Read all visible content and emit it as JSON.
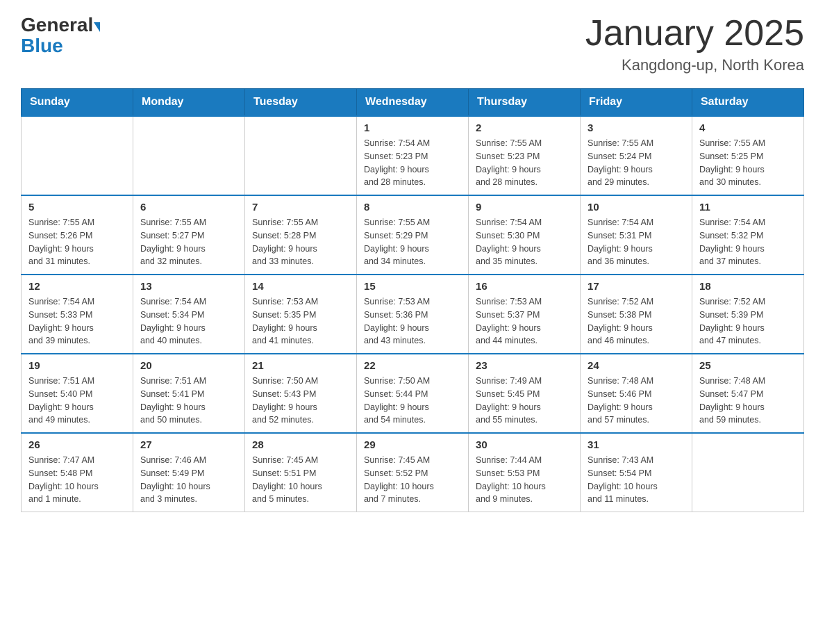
{
  "header": {
    "logo_general": "General",
    "logo_blue": "Blue",
    "main_title": "January 2025",
    "subtitle": "Kangdong-up, North Korea"
  },
  "days_of_week": [
    "Sunday",
    "Monday",
    "Tuesday",
    "Wednesday",
    "Thursday",
    "Friday",
    "Saturday"
  ],
  "weeks": [
    [
      {
        "day": "",
        "info": ""
      },
      {
        "day": "",
        "info": ""
      },
      {
        "day": "",
        "info": ""
      },
      {
        "day": "1",
        "info": "Sunrise: 7:54 AM\nSunset: 5:23 PM\nDaylight: 9 hours\nand 28 minutes."
      },
      {
        "day": "2",
        "info": "Sunrise: 7:55 AM\nSunset: 5:23 PM\nDaylight: 9 hours\nand 28 minutes."
      },
      {
        "day": "3",
        "info": "Sunrise: 7:55 AM\nSunset: 5:24 PM\nDaylight: 9 hours\nand 29 minutes."
      },
      {
        "day": "4",
        "info": "Sunrise: 7:55 AM\nSunset: 5:25 PM\nDaylight: 9 hours\nand 30 minutes."
      }
    ],
    [
      {
        "day": "5",
        "info": "Sunrise: 7:55 AM\nSunset: 5:26 PM\nDaylight: 9 hours\nand 31 minutes."
      },
      {
        "day": "6",
        "info": "Sunrise: 7:55 AM\nSunset: 5:27 PM\nDaylight: 9 hours\nand 32 minutes."
      },
      {
        "day": "7",
        "info": "Sunrise: 7:55 AM\nSunset: 5:28 PM\nDaylight: 9 hours\nand 33 minutes."
      },
      {
        "day": "8",
        "info": "Sunrise: 7:55 AM\nSunset: 5:29 PM\nDaylight: 9 hours\nand 34 minutes."
      },
      {
        "day": "9",
        "info": "Sunrise: 7:54 AM\nSunset: 5:30 PM\nDaylight: 9 hours\nand 35 minutes."
      },
      {
        "day": "10",
        "info": "Sunrise: 7:54 AM\nSunset: 5:31 PM\nDaylight: 9 hours\nand 36 minutes."
      },
      {
        "day": "11",
        "info": "Sunrise: 7:54 AM\nSunset: 5:32 PM\nDaylight: 9 hours\nand 37 minutes."
      }
    ],
    [
      {
        "day": "12",
        "info": "Sunrise: 7:54 AM\nSunset: 5:33 PM\nDaylight: 9 hours\nand 39 minutes."
      },
      {
        "day": "13",
        "info": "Sunrise: 7:54 AM\nSunset: 5:34 PM\nDaylight: 9 hours\nand 40 minutes."
      },
      {
        "day": "14",
        "info": "Sunrise: 7:53 AM\nSunset: 5:35 PM\nDaylight: 9 hours\nand 41 minutes."
      },
      {
        "day": "15",
        "info": "Sunrise: 7:53 AM\nSunset: 5:36 PM\nDaylight: 9 hours\nand 43 minutes."
      },
      {
        "day": "16",
        "info": "Sunrise: 7:53 AM\nSunset: 5:37 PM\nDaylight: 9 hours\nand 44 minutes."
      },
      {
        "day": "17",
        "info": "Sunrise: 7:52 AM\nSunset: 5:38 PM\nDaylight: 9 hours\nand 46 minutes."
      },
      {
        "day": "18",
        "info": "Sunrise: 7:52 AM\nSunset: 5:39 PM\nDaylight: 9 hours\nand 47 minutes."
      }
    ],
    [
      {
        "day": "19",
        "info": "Sunrise: 7:51 AM\nSunset: 5:40 PM\nDaylight: 9 hours\nand 49 minutes."
      },
      {
        "day": "20",
        "info": "Sunrise: 7:51 AM\nSunset: 5:41 PM\nDaylight: 9 hours\nand 50 minutes."
      },
      {
        "day": "21",
        "info": "Sunrise: 7:50 AM\nSunset: 5:43 PM\nDaylight: 9 hours\nand 52 minutes."
      },
      {
        "day": "22",
        "info": "Sunrise: 7:50 AM\nSunset: 5:44 PM\nDaylight: 9 hours\nand 54 minutes."
      },
      {
        "day": "23",
        "info": "Sunrise: 7:49 AM\nSunset: 5:45 PM\nDaylight: 9 hours\nand 55 minutes."
      },
      {
        "day": "24",
        "info": "Sunrise: 7:48 AM\nSunset: 5:46 PM\nDaylight: 9 hours\nand 57 minutes."
      },
      {
        "day": "25",
        "info": "Sunrise: 7:48 AM\nSunset: 5:47 PM\nDaylight: 9 hours\nand 59 minutes."
      }
    ],
    [
      {
        "day": "26",
        "info": "Sunrise: 7:47 AM\nSunset: 5:48 PM\nDaylight: 10 hours\nand 1 minute."
      },
      {
        "day": "27",
        "info": "Sunrise: 7:46 AM\nSunset: 5:49 PM\nDaylight: 10 hours\nand 3 minutes."
      },
      {
        "day": "28",
        "info": "Sunrise: 7:45 AM\nSunset: 5:51 PM\nDaylight: 10 hours\nand 5 minutes."
      },
      {
        "day": "29",
        "info": "Sunrise: 7:45 AM\nSunset: 5:52 PM\nDaylight: 10 hours\nand 7 minutes."
      },
      {
        "day": "30",
        "info": "Sunrise: 7:44 AM\nSunset: 5:53 PM\nDaylight: 10 hours\nand 9 minutes."
      },
      {
        "day": "31",
        "info": "Sunrise: 7:43 AM\nSunset: 5:54 PM\nDaylight: 10 hours\nand 11 minutes."
      },
      {
        "day": "",
        "info": ""
      }
    ]
  ]
}
